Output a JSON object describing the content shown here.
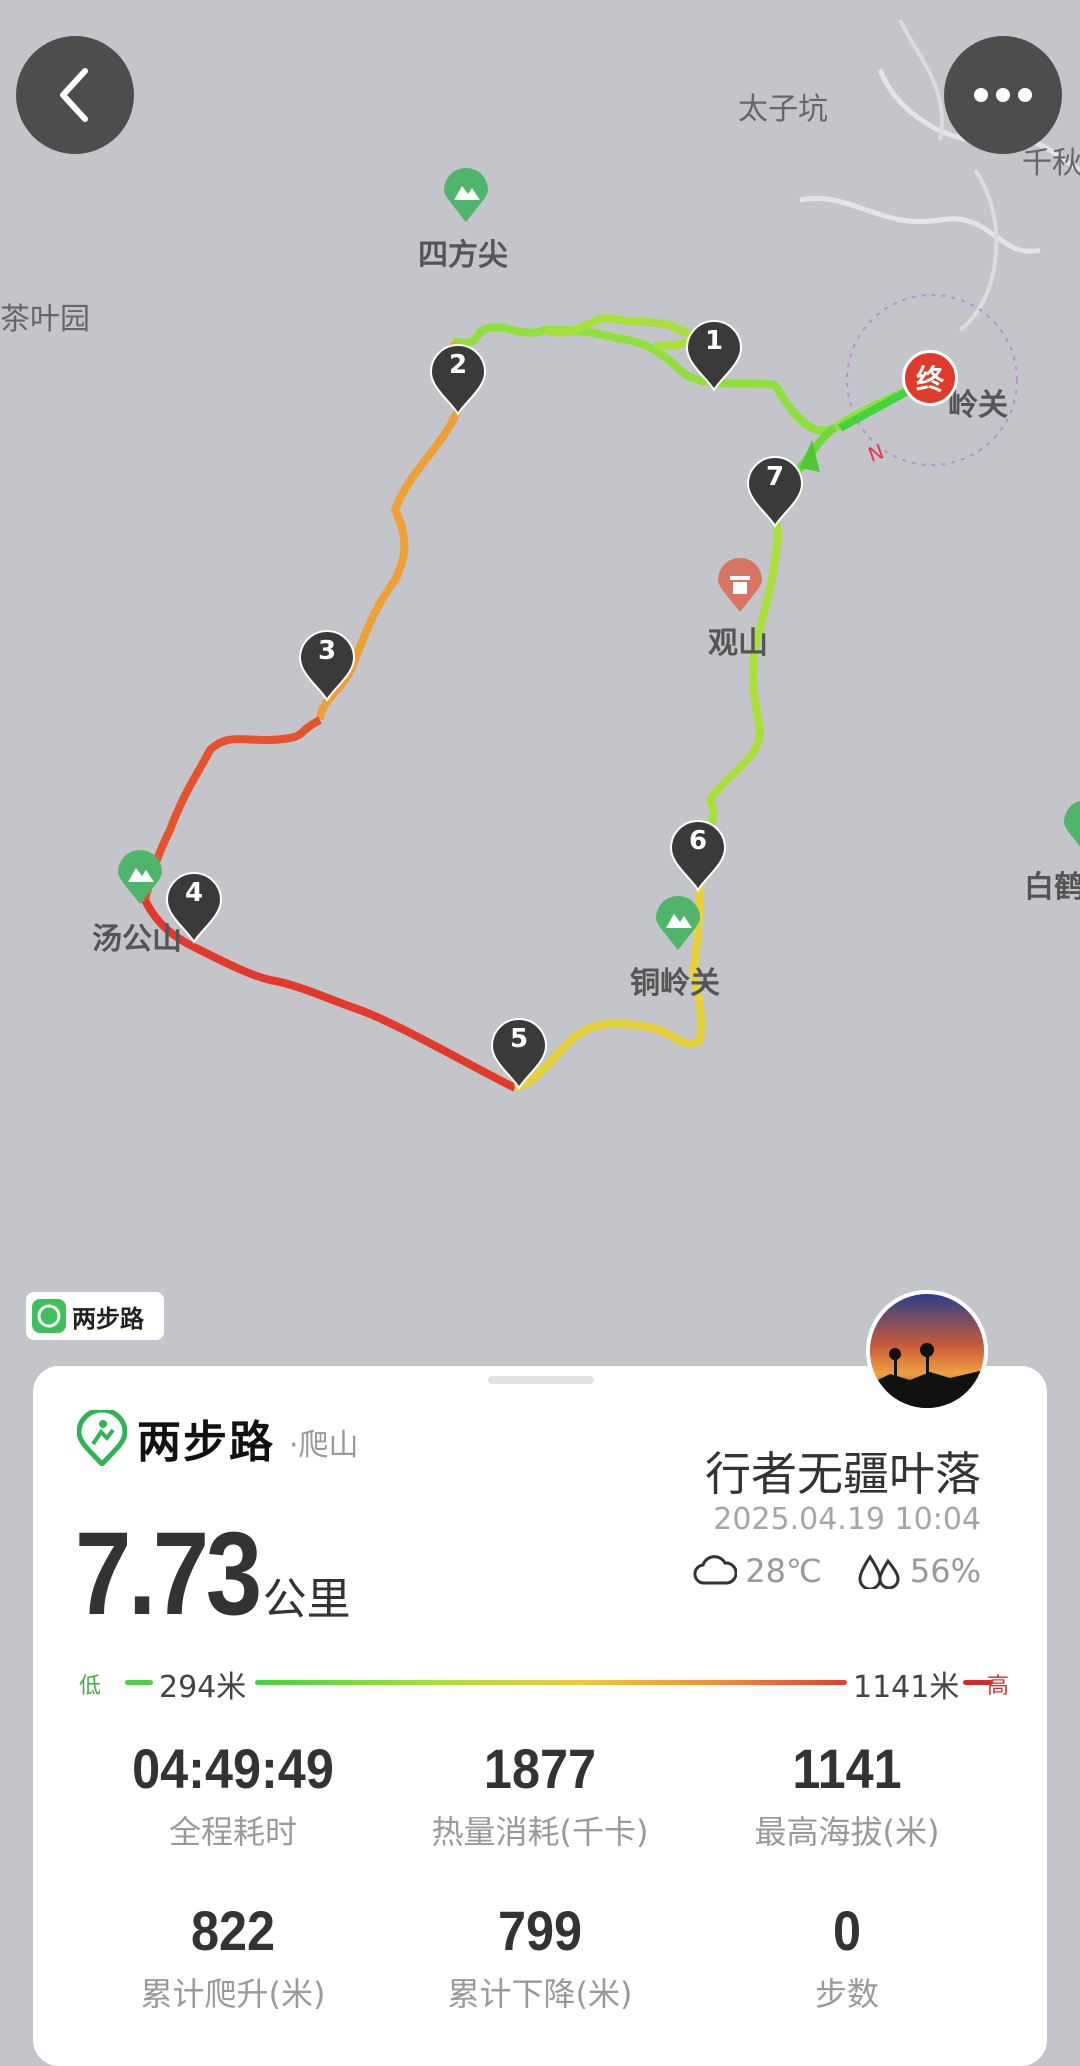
{
  "map": {
    "places": {
      "taizikeng": "太子坑",
      "qianqiu": "千秋",
      "sifangjian": "四方尖",
      "chayeyuan": "茶叶园",
      "lingguan": "岭关",
      "guanshan": "观山",
      "baihe": "白鹤",
      "tanggongshan": "汤公山",
      "tonglingguan": "铜岭关"
    },
    "end_marker": "终",
    "compass": "N",
    "waypoints": [
      "1",
      "2",
      "3",
      "4",
      "5",
      "6",
      "7"
    ],
    "watermark": "两步路"
  },
  "card": {
    "brand": "两步路",
    "activity": "·爬山",
    "distance_value": "7.73",
    "distance_unit": "公里",
    "user_name": "行者无疆叶落",
    "datetime": "2025.04.19 10:04",
    "temperature": "28℃",
    "humidity": "56%",
    "elevation": {
      "low_label": "低",
      "low_value": "294米",
      "high_value": "1141米",
      "high_label": "高"
    },
    "stats": [
      {
        "value": "04:49:49",
        "label": "全程耗时"
      },
      {
        "value": "1877",
        "label": "热量消耗(千卡)"
      },
      {
        "value": "1141",
        "label": "最高海拔(米)"
      },
      {
        "value": "822",
        "label": "累计爬升(米)"
      },
      {
        "value": "799",
        "label": "累计下降(米)"
      },
      {
        "value": "0",
        "label": "步数"
      }
    ]
  },
  "colors": {
    "route_low": "#42d43c",
    "route_high": "#e0302a",
    "marker_dark": "#3a3a3a",
    "end_red": "#e03a2a"
  }
}
